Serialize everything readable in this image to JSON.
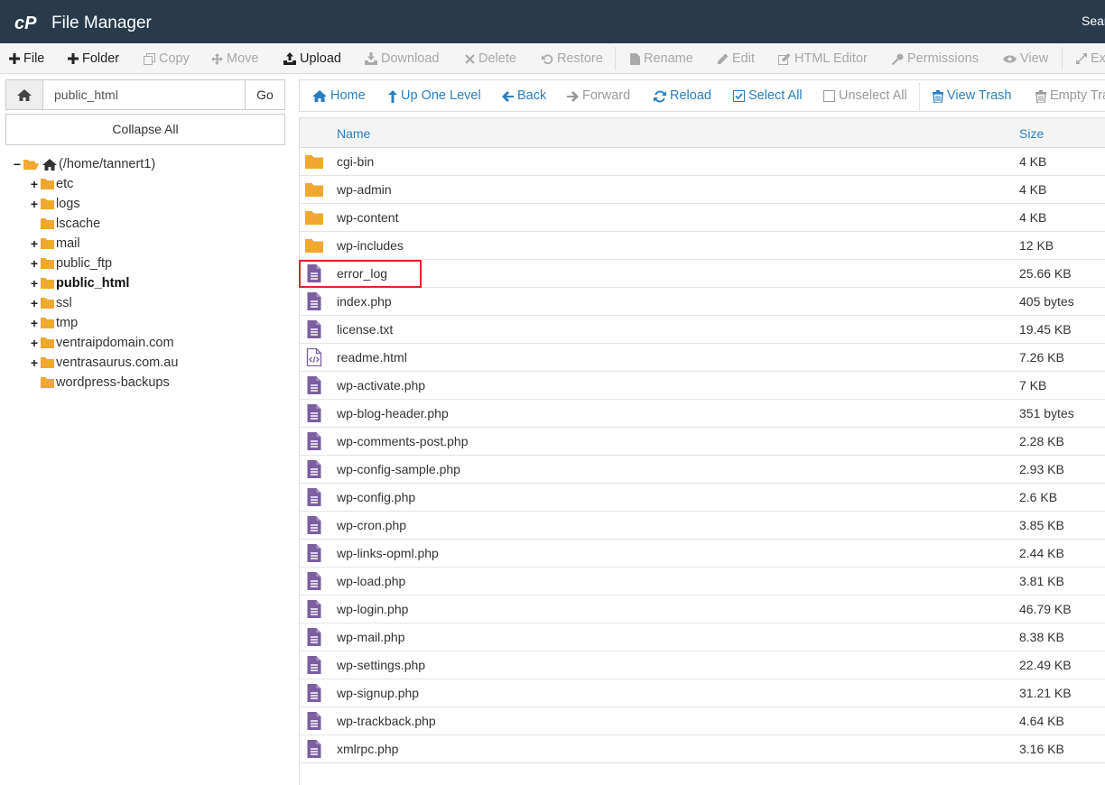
{
  "header": {
    "title": "File Manager",
    "search_label": "Sear"
  },
  "toolbar": {
    "file": "File",
    "folder": "Folder",
    "copy": "Copy",
    "move": "Move",
    "upload": "Upload",
    "download": "Download",
    "delete": "Delete",
    "restore": "Restore",
    "rename": "Rename",
    "edit": "Edit",
    "html_editor": "HTML Editor",
    "permissions": "Permissions",
    "view": "View",
    "extract": "Ex"
  },
  "path": {
    "value": "public_html",
    "go": "Go"
  },
  "collapse_all": "Collapse All",
  "tree": {
    "root": "(/home/tannert1)",
    "items": [
      {
        "label": "etc",
        "toggle": "+"
      },
      {
        "label": "logs",
        "toggle": "+"
      },
      {
        "label": "lscache",
        "toggle": ""
      },
      {
        "label": "mail",
        "toggle": "+"
      },
      {
        "label": "public_ftp",
        "toggle": "+"
      },
      {
        "label": "public_html",
        "toggle": "+"
      },
      {
        "label": "ssl",
        "toggle": "+"
      },
      {
        "label": "tmp",
        "toggle": "+"
      },
      {
        "label": "ventraipdomain.com",
        "toggle": "+"
      },
      {
        "label": "ventrasaurus.com.au",
        "toggle": "+"
      },
      {
        "label": "wordpress-backups",
        "toggle": ""
      }
    ]
  },
  "nav": {
    "home": "Home",
    "up": "Up One Level",
    "back": "Back",
    "forward": "Forward",
    "reload": "Reload",
    "select_all": "Select All",
    "unselect_all": "Unselect All",
    "view_trash": "View Trash",
    "empty_trash": "Empty Tra"
  },
  "table": {
    "col_name": "Name",
    "col_size": "Size",
    "rows": [
      {
        "name": "cgi-bin",
        "size": "4 KB",
        "type": "folder"
      },
      {
        "name": "wp-admin",
        "size": "4 KB",
        "type": "folder"
      },
      {
        "name": "wp-content",
        "size": "4 KB",
        "type": "folder"
      },
      {
        "name": "wp-includes",
        "size": "12 KB",
        "type": "folder"
      },
      {
        "name": "error_log",
        "size": "25.66 KB",
        "type": "file"
      },
      {
        "name": "index.php",
        "size": "405 bytes",
        "type": "file"
      },
      {
        "name": "license.txt",
        "size": "19.45 KB",
        "type": "file"
      },
      {
        "name": "readme.html",
        "size": "7.26 KB",
        "type": "html"
      },
      {
        "name": "wp-activate.php",
        "size": "7 KB",
        "type": "file"
      },
      {
        "name": "wp-blog-header.php",
        "size": "351 bytes",
        "type": "file"
      },
      {
        "name": "wp-comments-post.php",
        "size": "2.28 KB",
        "type": "file"
      },
      {
        "name": "wp-config-sample.php",
        "size": "2.93 KB",
        "type": "file"
      },
      {
        "name": "wp-config.php",
        "size": "2.6 KB",
        "type": "file"
      },
      {
        "name": "wp-cron.php",
        "size": "3.85 KB",
        "type": "file"
      },
      {
        "name": "wp-links-opml.php",
        "size": "2.44 KB",
        "type": "file"
      },
      {
        "name": "wp-load.php",
        "size": "3.81 KB",
        "type": "file"
      },
      {
        "name": "wp-login.php",
        "size": "46.79 KB",
        "type": "file"
      },
      {
        "name": "wp-mail.php",
        "size": "8.38 KB",
        "type": "file"
      },
      {
        "name": "wp-settings.php",
        "size": "22.49 KB",
        "type": "file"
      },
      {
        "name": "wp-signup.php",
        "size": "31.21 KB",
        "type": "file"
      },
      {
        "name": "wp-trackback.php",
        "size": "4.64 KB",
        "type": "file"
      },
      {
        "name": "xmlrpc.php",
        "size": "3.16 KB",
        "type": "file"
      }
    ]
  },
  "colors": {
    "header_bg": "#293a4a",
    "link_blue": "#2b7ec1",
    "folder": "#f0a830",
    "file": "#7b5fa0",
    "highlight": "#e0242c"
  }
}
